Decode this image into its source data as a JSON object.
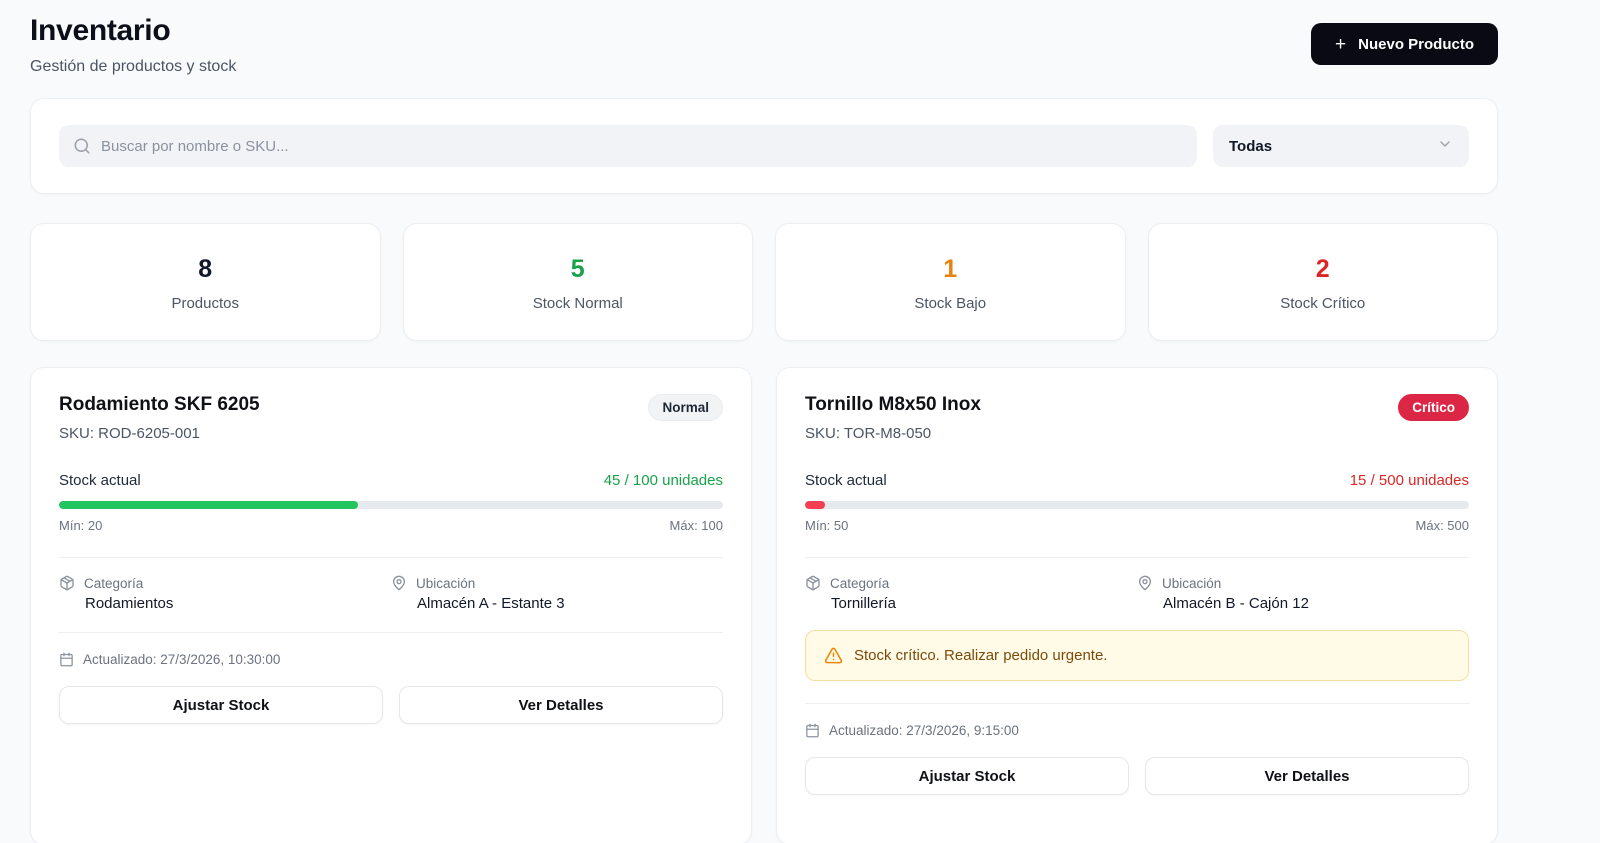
{
  "header": {
    "title": "Inventario",
    "subtitle": "Gestión de productos y stock",
    "new_product_label": "Nuevo Producto",
    "plus_glyph": "+"
  },
  "filters": {
    "search_placeholder": "Buscar por nombre o SKU...",
    "category_selected": "Todas"
  },
  "stats": [
    {
      "value": "8",
      "label": "Productos",
      "color": "#111827"
    },
    {
      "value": "5",
      "label": "Stock Normal",
      "color": "#16a34a"
    },
    {
      "value": "1",
      "label": "Stock Bajo",
      "color": "#e8820c"
    },
    {
      "value": "2",
      "label": "Stock Crítico",
      "color": "#dc2626"
    }
  ],
  "products": [
    {
      "name": "Rodamiento SKF 6205",
      "sku": "SKU: ROD-6205-001",
      "badge": "Normal",
      "stock": {
        "label": "Stock actual",
        "value": "45 / 100 unidades",
        "value_color": "#16a34a",
        "percent": 45,
        "bar_color": "#22c55e",
        "min_label": "Mín: 20",
        "max_label": "Máx: 100"
      },
      "category": {
        "label": "Categoría",
        "value": "Rodamientos"
      },
      "location": {
        "label": "Ubicación",
        "value": "Almacén A - Estante 3"
      },
      "updated": "Actualizado: 27/3/2026, 10:30:00",
      "actions": {
        "adjust": "Ajustar Stock",
        "details": "Ver Detalles"
      }
    },
    {
      "name": "Tornillo M8x50 Inox",
      "sku": "SKU: TOR-M8-050",
      "badge": "Crítico",
      "stock": {
        "label": "Stock actual",
        "value": "15 / 500 unidades",
        "value_color": "#dc2626",
        "percent": 3,
        "bar_color": "#f43f53",
        "min_label": "Mín: 50",
        "max_label": "Máx: 500"
      },
      "category": {
        "label": "Categoría",
        "value": "Tornillería"
      },
      "location": {
        "label": "Ubicación",
        "value": "Almacén B - Cajón 12"
      },
      "warning": "Stock crítico. Realizar pedido urgente.",
      "updated": "Actualizado: 27/3/2026, 9:15:00",
      "actions": {
        "adjust": "Ajustar Stock",
        "details": "Ver Detalles"
      }
    }
  ]
}
